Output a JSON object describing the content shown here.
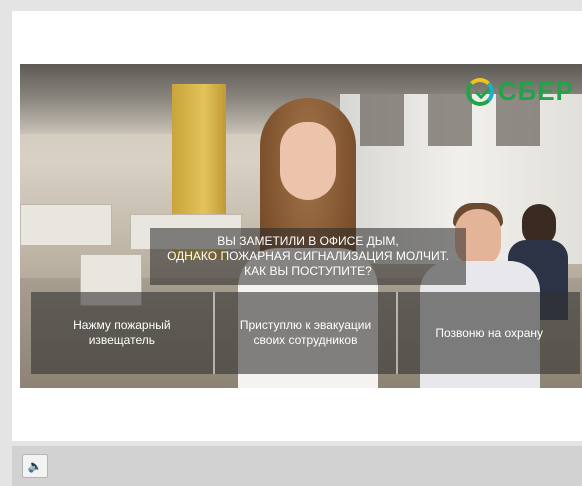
{
  "brand": {
    "name": "СБЕР",
    "color": "#22a34a"
  },
  "question": {
    "text": "ВЫ ЗАМЕТИЛИ В ОФИСЕ ДЫМ,\nОДНАКО ПОЖАРНАЯ СИГНАЛИЗАЦИЯ МОЛЧИТ.\nКАК ВЫ ПОСТУПИТЕ?"
  },
  "answers": [
    {
      "label": "Нажму пожарный\nизвещатель"
    },
    {
      "label": "Приступлю к эвакуации\nсвоих сотрудников"
    },
    {
      "label": "Позвоню на охрану"
    }
  ],
  "controls": {
    "sound_icon": "speaker-icon",
    "sound_glyph": "🔈"
  }
}
